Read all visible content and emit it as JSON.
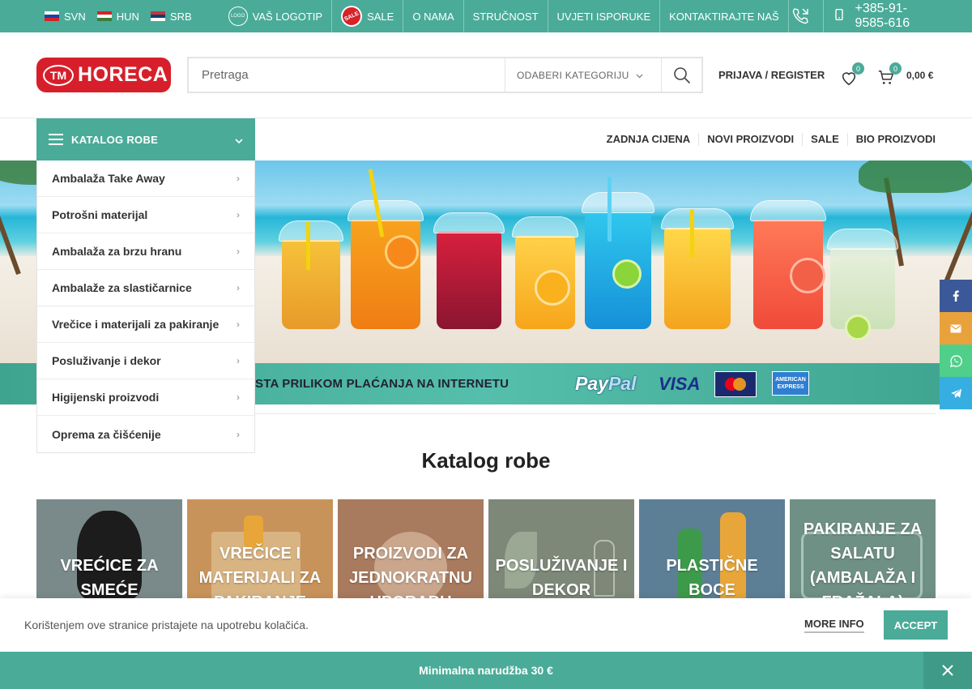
{
  "topbar": {
    "languages": [
      {
        "code": "SVN"
      },
      {
        "code": "HUN"
      },
      {
        "code": "SRB"
      }
    ],
    "logo_badge_text": "LOGO",
    "sale_badge_text": "SALE",
    "nav": [
      {
        "label": "VAŠ LOGOTIP"
      },
      {
        "label": "SALE"
      },
      {
        "label": "O NAMA"
      },
      {
        "label": "STRUČNOST"
      },
      {
        "label": "UVJETI ISPORUKE"
      },
      {
        "label": "KONTAKTIRAJTE NAŠ"
      }
    ],
    "phone": "+385-91-9585-616"
  },
  "header": {
    "logo_tm": "TM",
    "logo_word": "HORECA",
    "search_placeholder": "Pretraga",
    "category_select": "ODABERI KATEGORIJU",
    "login_label": "PRIJAVA / REGISTER",
    "wishlist_count": "0",
    "cart_count": "0",
    "cart_total": "0,00 €"
  },
  "catalog": {
    "title": "KATALOG ROBE",
    "items": [
      {
        "label": "Ambalaža Take Away"
      },
      {
        "label": "Potrošni materijal"
      },
      {
        "label": "Ambalaža za brzu hranu"
      },
      {
        "label": "Ambalaže za slastičarnice"
      },
      {
        "label": "Vrečice i materijali za pakiranje"
      },
      {
        "label": "Posluživanje i dekor"
      },
      {
        "label": "Higijenski proizvodi"
      },
      {
        "label": "Oprema za čišćenije"
      }
    ]
  },
  "mainnav": [
    {
      "label": "ZADNJA CIJENA"
    },
    {
      "label": "NOVI PROIZVODI"
    },
    {
      "label": "SALE"
    },
    {
      "label": "BIO PROIZVODI"
    }
  ],
  "paybar": {
    "text": "STA PRILIKOM PLAĆANJA NA INTERNETU",
    "paypal_a": "Pay",
    "paypal_b": "Pal",
    "visa": "VISA",
    "mastercard": "MasterCard",
    "amex_top": "AMERICAN",
    "amex_bottom": "EXPRESS"
  },
  "section_title": "Katalog robe",
  "tiles": [
    {
      "label": "VREĆICE ZA SMEĆE",
      "color": "#7a8a8a"
    },
    {
      "label": "VREČICE I MATERIJALI ZA PAKIRANJE",
      "color": "#c8935a"
    },
    {
      "label": "PROIZVODI ZA JEDNOKRATNU UPORABU",
      "color": "#a87a5e"
    },
    {
      "label": "POSLUŽIVANJE I DEKOR",
      "color": "#7d8878"
    },
    {
      "label": "PLASTIČNE BOCE",
      "color": "#5c7f96"
    },
    {
      "label": "PAKIRANJE ZA SALATU (AMBALAŽA I FRAŽALA)",
      "color": "#6f9085"
    }
  ],
  "cookie": {
    "text": "Korištenjem ove stranice pristajete na upotrebu kolačića.",
    "more_info": "MORE INFO",
    "accept": "ACCEPT"
  },
  "min_order": "Minimalna narudžba 30 €",
  "colors": {
    "accent": "#4aab98",
    "brand_red": "#d71f2b"
  },
  "social": [
    {
      "icon": "facebook-icon",
      "color": "#3b5998"
    },
    {
      "icon": "email-icon",
      "color": "#e9a23b"
    },
    {
      "icon": "whatsapp-icon",
      "color": "#4fcf8a"
    },
    {
      "icon": "telegram-icon",
      "color": "#37aee2"
    }
  ]
}
